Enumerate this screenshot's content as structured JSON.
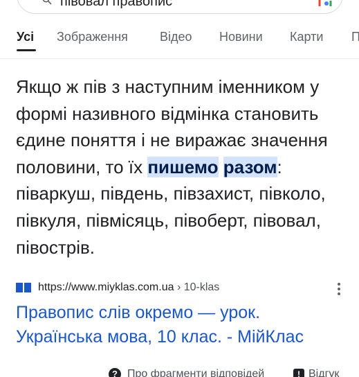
{
  "search": {
    "query": "півовал правопис"
  },
  "tabs": [
    {
      "label": "Усі",
      "active": true
    },
    {
      "label": "Зображення",
      "active": false
    },
    {
      "label": "Відео",
      "active": false
    },
    {
      "label": "Новини",
      "active": false
    },
    {
      "label": "Карти",
      "active": false
    },
    {
      "label": "П",
      "active": false
    }
  ],
  "snippet": {
    "before": "Якщо ж пів з наступним іменником у формі називного відмінка становить єдине поняття і не виражає значення половини, то їх ",
    "highlight_1": "пишемо",
    "highlight_2": "разом",
    "after": ": піваркуш, південь, півзахист, півколо, півкуля, півмісяць, півоберт, півовал, півострів."
  },
  "source": {
    "url": "https://www.miyklas.com.ua",
    "breadcrumb": "› 10-klas",
    "icon": "book-icon"
  },
  "result": {
    "title": "Правопис слів окремо — урок. Українська мова, 10 клас. - МійКлас"
  },
  "footer": {
    "about_label": "Про фрагменти відповідей",
    "feedback_label": "Відгук"
  },
  "colors": {
    "link": "#1a57c8",
    "highlight_bg": "#d3e3fd",
    "site_icon": "#1a57c8"
  }
}
